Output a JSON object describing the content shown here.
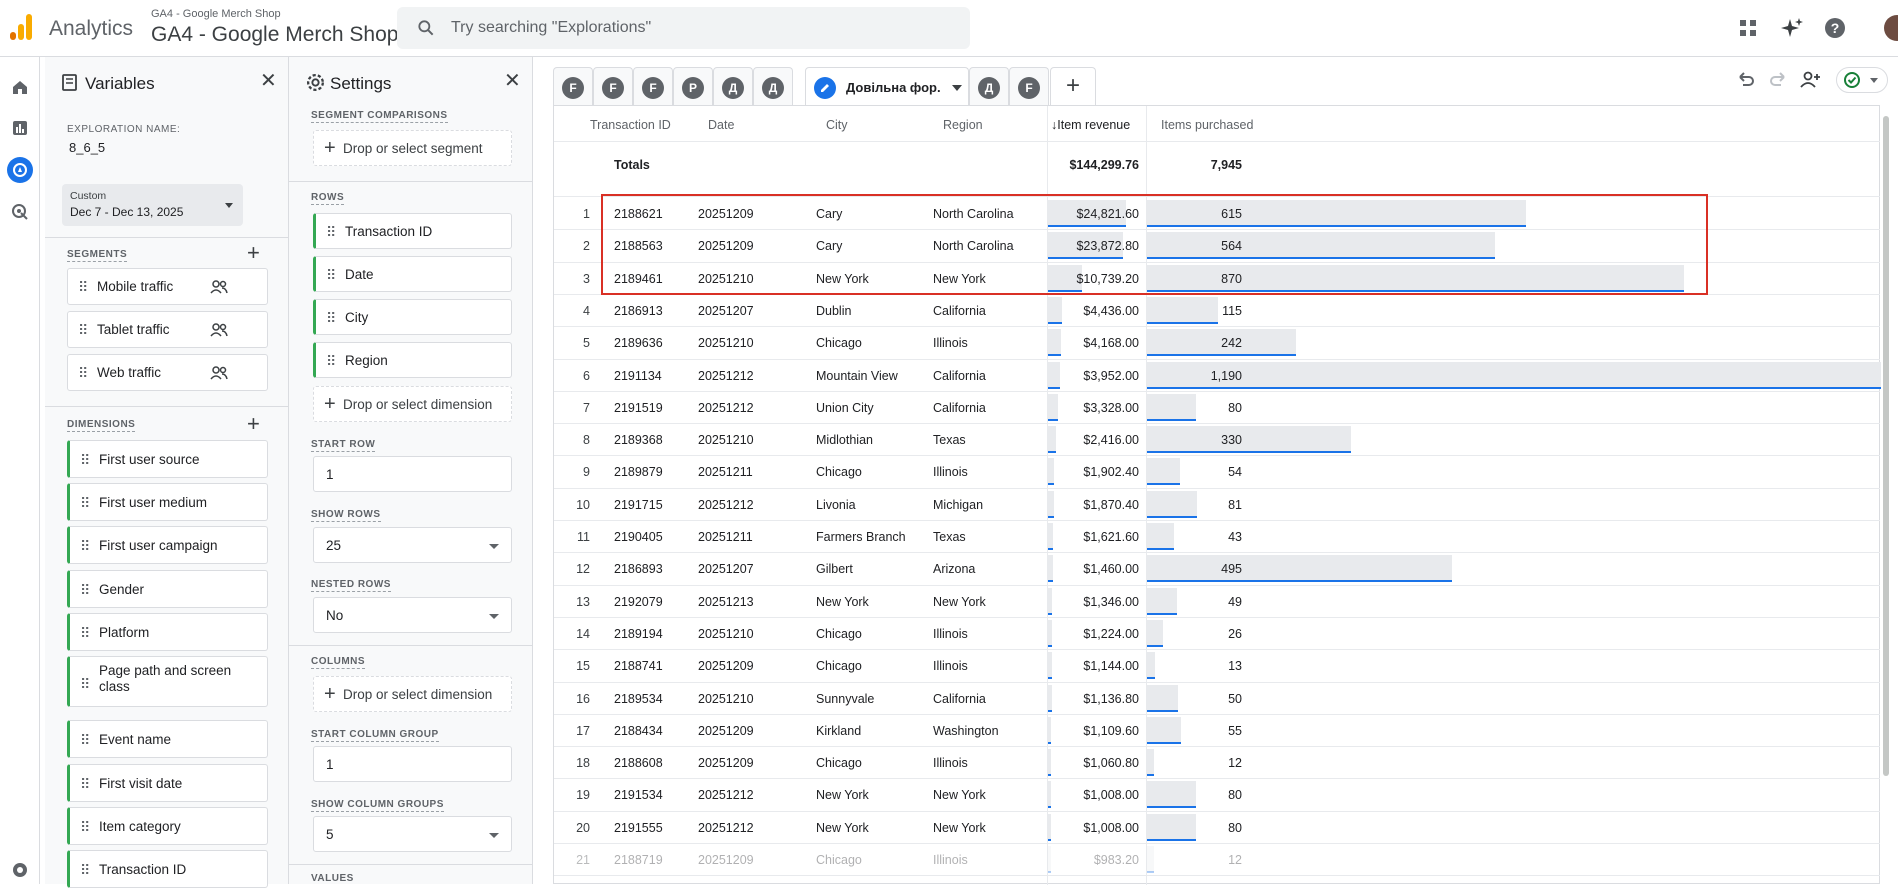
{
  "header": {
    "app_name": "Analytics",
    "property_small": "GA4 - Google Merch Shop",
    "property_name": "GA4 - Google Merch Shop",
    "search_placeholder": "Try searching \"Explorations\""
  },
  "variables": {
    "title": "Variables",
    "exploration_label": "EXPLORATION NAME:",
    "exploration_name": "8_6_5",
    "date_label": "Custom",
    "date_range": "Dec 7 - Dec 13, 2025",
    "segments_label": "SEGMENTS",
    "segments": [
      "Mobile traffic",
      "Tablet traffic",
      "Web traffic"
    ],
    "dimensions_label": "DIMENSIONS",
    "dimensions": [
      "First user source",
      "First user medium",
      "First user campaign",
      "Gender",
      "Platform",
      "Page path and screen class",
      "Event name",
      "First visit date",
      "Item category",
      "Transaction ID"
    ]
  },
  "settings": {
    "title": "Settings",
    "segment_comparisons_label": "SEGMENT COMPARISONS",
    "drop_segment": "Drop or select segment",
    "rows_label": "ROWS",
    "rows": [
      "Transaction ID",
      "Date",
      "City",
      "Region"
    ],
    "drop_dimension": "Drop or select dimension",
    "start_row_label": "START ROW",
    "start_row": "1",
    "show_rows_label": "SHOW ROWS",
    "show_rows": "25",
    "nested_rows_label": "NESTED ROWS",
    "nested_rows": "No",
    "columns_label": "COLUMNS",
    "drop_column": "Drop or select dimension",
    "start_column_group_label": "START COLUMN GROUP",
    "start_column_group": "1",
    "show_column_groups_label": "SHOW COLUMN GROUPS",
    "show_column_groups": "5",
    "values_label": "VALUES"
  },
  "tabs": {
    "letters": [
      "F",
      "F",
      "F",
      "P",
      "Д",
      "Д"
    ],
    "active_label": "Довільна фор...",
    "after_letters": [
      "Д",
      "F"
    ]
  },
  "table": {
    "headers": [
      "Transaction ID",
      "Date",
      "City",
      "Region",
      "Item revenue",
      "Items purchased"
    ],
    "totals_label": "Totals",
    "totals_revenue": "$144,299.76",
    "totals_items": "7,945",
    "rows": [
      {
        "n": "1",
        "id": "2188621",
        "date": "20251209",
        "city": "Cary",
        "region": "North Carolina",
        "rev": "$24,821.60",
        "items": "615",
        "rev_v": 24821.6,
        "items_v": 615
      },
      {
        "n": "2",
        "id": "2188563",
        "date": "20251209",
        "city": "Cary",
        "region": "North Carolina",
        "rev": "$23,872.80",
        "items": "564",
        "rev_v": 23872.8,
        "items_v": 564
      },
      {
        "n": "3",
        "id": "2189461",
        "date": "20251210",
        "city": "New York",
        "region": "New York",
        "rev": "$10,739.20",
        "items": "870",
        "rev_v": 10739.2,
        "items_v": 870
      },
      {
        "n": "4",
        "id": "2186913",
        "date": "20251207",
        "city": "Dublin",
        "region": "California",
        "rev": "$4,436.00",
        "items": "115",
        "rev_v": 4436.0,
        "items_v": 115
      },
      {
        "n": "5",
        "id": "2189636",
        "date": "20251210",
        "city": "Chicago",
        "region": "Illinois",
        "rev": "$4,168.00",
        "items": "242",
        "rev_v": 4168.0,
        "items_v": 242
      },
      {
        "n": "6",
        "id": "2191134",
        "date": "20251212",
        "city": "Mountain View",
        "region": "California",
        "rev": "$3,952.00",
        "items": "1,190",
        "rev_v": 3952.0,
        "items_v": 1190
      },
      {
        "n": "7",
        "id": "2191519",
        "date": "20251212",
        "city": "Union City",
        "region": "California",
        "rev": "$3,328.00",
        "items": "80",
        "rev_v": 3328.0,
        "items_v": 80
      },
      {
        "n": "8",
        "id": "2189368",
        "date": "20251210",
        "city": "Midlothian",
        "region": "Texas",
        "rev": "$2,416.00",
        "items": "330",
        "rev_v": 2416.0,
        "items_v": 330
      },
      {
        "n": "9",
        "id": "2189879",
        "date": "20251211",
        "city": "Chicago",
        "region": "Illinois",
        "rev": "$1,902.40",
        "items": "54",
        "rev_v": 1902.4,
        "items_v": 54
      },
      {
        "n": "10",
        "id": "2191715",
        "date": "20251212",
        "city": "Livonia",
        "region": "Michigan",
        "rev": "$1,870.40",
        "items": "81",
        "rev_v": 1870.4,
        "items_v": 81
      },
      {
        "n": "11",
        "id": "2190405",
        "date": "20251211",
        "city": "Farmers Branch",
        "region": "Texas",
        "rev": "$1,621.60",
        "items": "43",
        "rev_v": 1621.6,
        "items_v": 43
      },
      {
        "n": "12",
        "id": "2186893",
        "date": "20251207",
        "city": "Gilbert",
        "region": "Arizona",
        "rev": "$1,460.00",
        "items": "495",
        "rev_v": 1460.0,
        "items_v": 495
      },
      {
        "n": "13",
        "id": "2192079",
        "date": "20251213",
        "city": "New York",
        "region": "New York",
        "rev": "$1,346.00",
        "items": "49",
        "rev_v": 1346.0,
        "items_v": 49
      },
      {
        "n": "14",
        "id": "2189194",
        "date": "20251210",
        "city": "Chicago",
        "region": "Illinois",
        "rev": "$1,224.00",
        "items": "26",
        "rev_v": 1224.0,
        "items_v": 26
      },
      {
        "n": "15",
        "id": "2188741",
        "date": "20251209",
        "city": "Chicago",
        "region": "Illinois",
        "rev": "$1,144.00",
        "items": "13",
        "rev_v": 1144.0,
        "items_v": 13
      },
      {
        "n": "16",
        "id": "2189534",
        "date": "20251210",
        "city": "Sunnyvale",
        "region": "California",
        "rev": "$1,136.80",
        "items": "50",
        "rev_v": 1136.8,
        "items_v": 50
      },
      {
        "n": "17",
        "id": "2188434",
        "date": "20251209",
        "city": "Kirkland",
        "region": "Washington",
        "rev": "$1,109.60",
        "items": "55",
        "rev_v": 1109.6,
        "items_v": 55
      },
      {
        "n": "18",
        "id": "2188608",
        "date": "20251209",
        "city": "Chicago",
        "region": "Illinois",
        "rev": "$1,060.80",
        "items": "12",
        "rev_v": 1060.8,
        "items_v": 12
      },
      {
        "n": "19",
        "id": "2191534",
        "date": "20251212",
        "city": "New York",
        "region": "New York",
        "rev": "$1,008.00",
        "items": "80",
        "rev_v": 1008.0,
        "items_v": 80
      },
      {
        "n": "20",
        "id": "2191555",
        "date": "20251212",
        "city": "New York",
        "region": "New York",
        "rev": "$1,008.00",
        "items": "80",
        "rev_v": 1008.0,
        "items_v": 80
      },
      {
        "n": "21",
        "id": "2188719",
        "date": "20251209",
        "city": "Chicago",
        "region": "Illinois",
        "rev": "$983.20",
        "items": "12",
        "rev_v": 983.2,
        "items_v": 12
      }
    ]
  },
  "colors": {
    "accent": "#1a73e8",
    "highlight": "#d93025",
    "chip_border": "#34a853"
  }
}
